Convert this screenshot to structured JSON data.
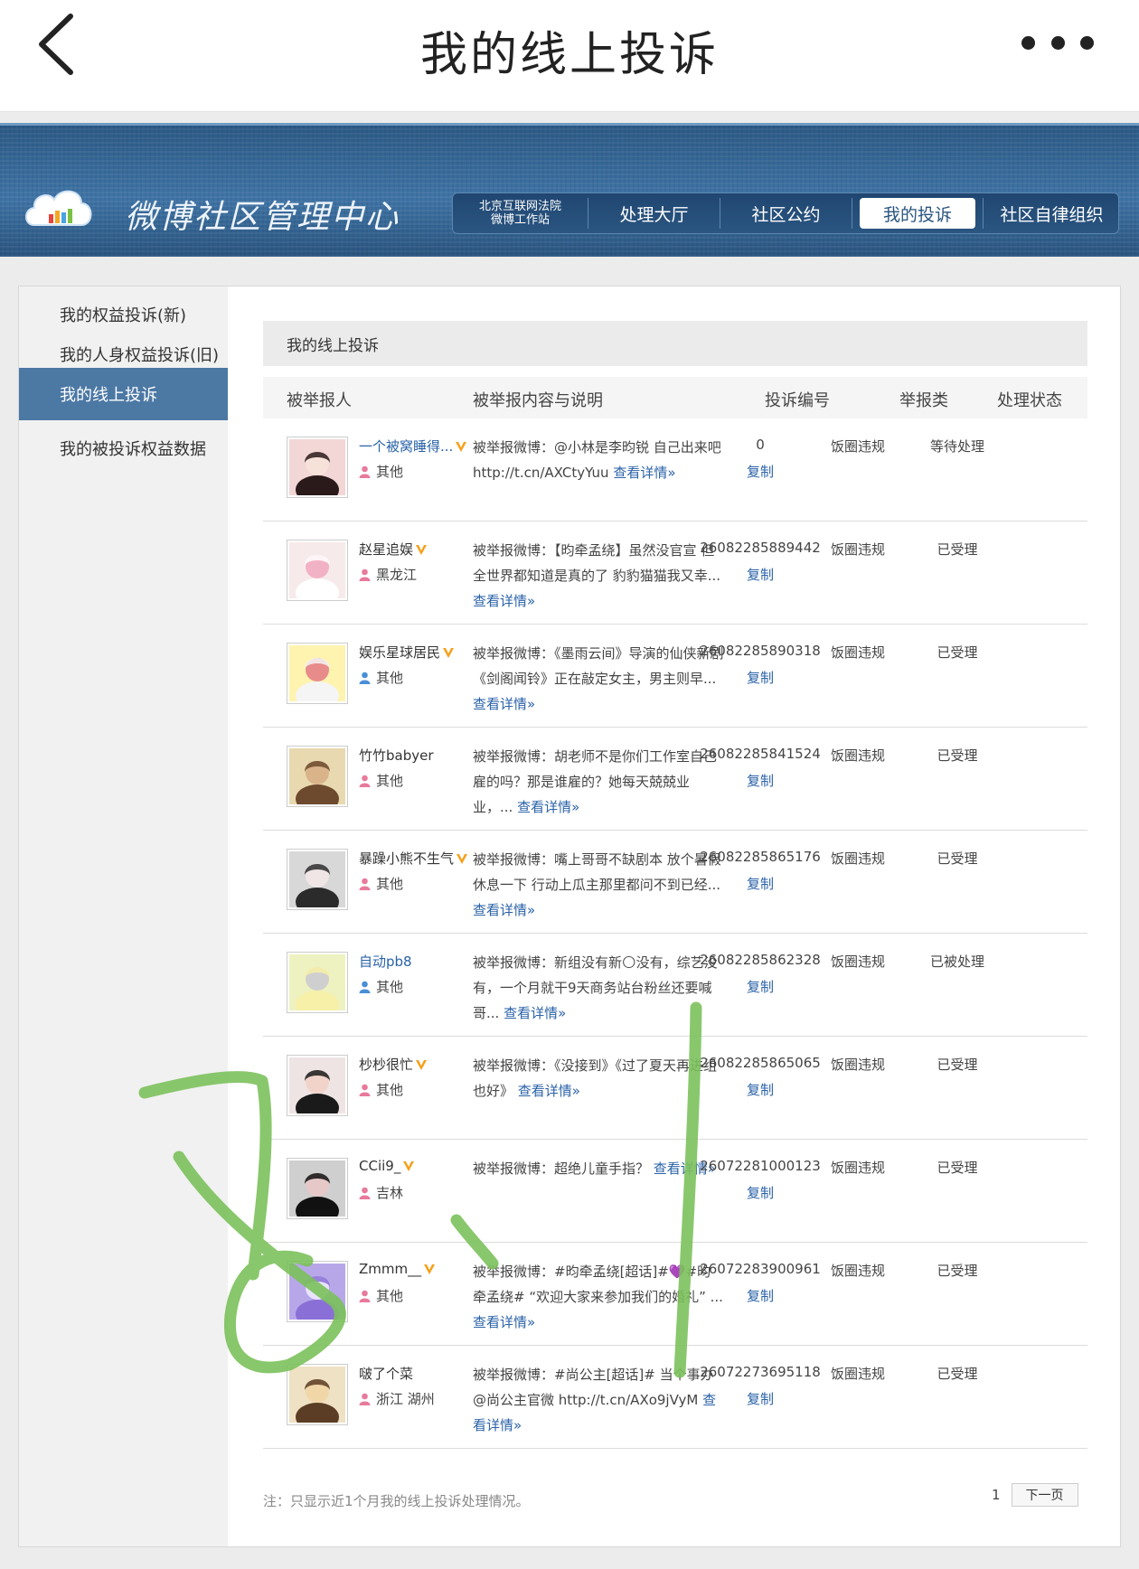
{
  "appbar": {
    "title": "我的线上投诉"
  },
  "banner": {
    "brand": "微博社区管理中心",
    "nav": {
      "court_line1": "北京互联网法院",
      "court_line2": "微博工作站",
      "hall": "处理大厅",
      "convention": "社区公约",
      "my_complaints": "我的投诉",
      "self_discipline": "社区自律组织"
    }
  },
  "sidebar": {
    "items": [
      "我的权益投诉(新)",
      "我的人身权益投诉(旧)",
      "我的线上投诉",
      "我的被投诉权益数据"
    ]
  },
  "main": {
    "section_title": "我的线上投诉",
    "columns": [
      "被举报人",
      "被举报内容与说明",
      "投诉编号",
      "举报类",
      "处理状态"
    ],
    "copy_label": "复制",
    "rows": [
      {
        "name": "一个被窝睡得...",
        "loc": "其他",
        "content": "被举报微博：@小林是李昀锐 自己出来吧 http://t.cn/AXCtyYuu",
        "more": "查看详情»",
        "num": "0",
        "cat": "饭圈违规",
        "status": "等待处理"
      },
      {
        "name": "赵星追娱",
        "loc": "黑龙江",
        "content": "被举报微博：【昀牵孟绕】虽然没官宣 但全世界都知道是真的了 豹豹猫猫我又幸...",
        "more": "查看详情»",
        "num": "26082285889442",
        "cat": "饭圈违规",
        "status": "已受理"
      },
      {
        "name": "娱乐星球居民",
        "loc": "其他",
        "content": "被举报微博：《墨雨云间》导演的仙侠新剧《剑阁闻铃》正在敲定女主，男主则早...",
        "more": "查看详情»",
        "num": "26082285890318",
        "cat": "饭圈违规",
        "status": "已受理"
      },
      {
        "name": "竹竹babyer",
        "loc": "其他",
        "content": "被举报微博：胡老师不是你们工作室自己雇的吗？那是谁雇的？她每天兢兢业业，...",
        "more": "查看详情»",
        "num": "26082285841524",
        "cat": "饭圈违规",
        "status": "已受理"
      },
      {
        "name": "暴躁小熊不生气",
        "loc": "其他",
        "content": "被举报微博：嘴上哥哥不缺剧本 放个暑假休息一下 行动上瓜主那里都问不到已经...",
        "more": "查看详情»",
        "num": "26082285865176",
        "cat": "饭圈违规",
        "status": "已受理"
      },
      {
        "name": "自动pb8",
        "loc": "其他",
        "content": "被举报微博：新组没有新🌕没有，综艺没有，一个月就干9天商务站台粉丝还要喊哥...",
        "more": "查看详情»",
        "num": "26082285862328",
        "cat": "饭圈违规",
        "status": "已被处理"
      },
      {
        "name": "杪杪很忙",
        "loc": "其他",
        "content": "被举报微博：《没接到》《过了夏天再进组也好》",
        "more": "查看详情»",
        "num": "26082285865065",
        "cat": "饭圈违规",
        "status": "已受理"
      },
      {
        "name": "CCii9_",
        "loc": "吉林",
        "content": "被举报微博：超绝儿童手指？",
        "more": "查看详情»",
        "num": "26072281000123",
        "cat": "饭圈违规",
        "status": "已受理"
      },
      {
        "name": "Zmmm__",
        "loc": "其他",
        "content": "被举报微博：#昀牵孟绕[超话]#💜#昀牵孟绕# “欢迎大家来参加我们的婚礼” ...",
        "more": "查看详情»",
        "num": "26072283900961",
        "cat": "饭圈违规",
        "status": "已受理"
      },
      {
        "name": "啵了个菜",
        "loc": "浙江 湖州",
        "content": "被举报微博：#尚公主[超话]# 当个事办@尚公主官微 http://t.cn/AXo9jVyM",
        "more": "查看详情»",
        "num": "26072273695118",
        "cat": "饭圈违规",
        "status": "已受理"
      }
    ]
  },
  "footer": {
    "note": "注：只显示近1个月我的线上投诉处理情况。",
    "page": "1",
    "next": "下一页"
  }
}
